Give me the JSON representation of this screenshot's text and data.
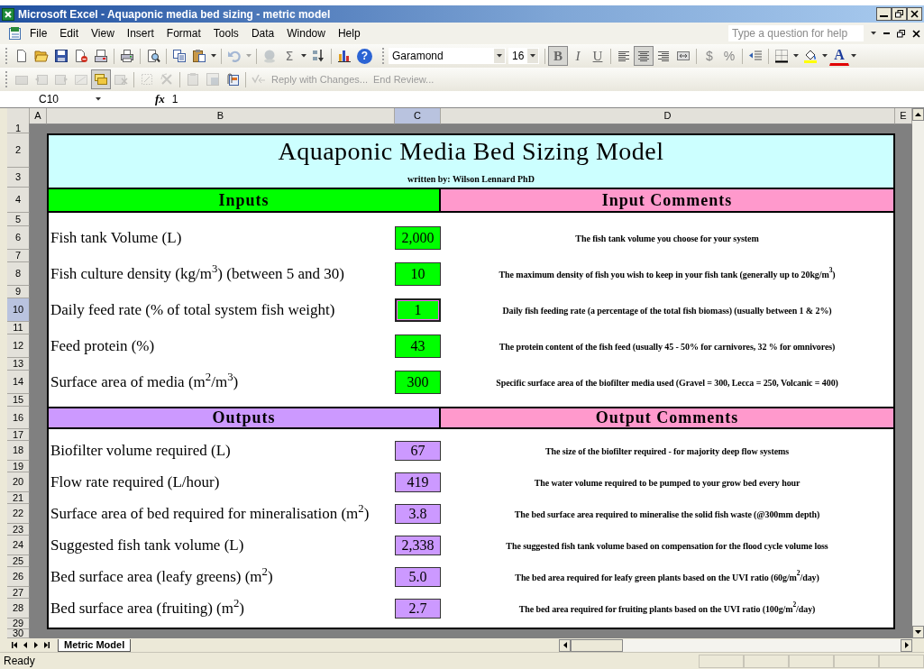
{
  "window": {
    "title": "Microsoft Excel - Aquaponic media bed sizing - metric model"
  },
  "menu": [
    "File",
    "Edit",
    "View",
    "Insert",
    "Format",
    "Tools",
    "Data",
    "Window",
    "Help"
  ],
  "help_box": {
    "placeholder": "Type a question for help"
  },
  "standard_toolbar": [
    {
      "kind": "icon",
      "disabled": false
    },
    {
      "kind": "icon",
      "disabled": false
    },
    {
      "kind": "icon",
      "disabled": false
    },
    {
      "kind": "icon",
      "disabled": false
    },
    {
      "kind": "icon",
      "disabled": false
    },
    {
      "kind": "separator"
    },
    {
      "kind": "icon",
      "disabled": false
    },
    {
      "kind": "separator"
    },
    {
      "kind": "icon",
      "disabled": false
    },
    {
      "kind": "separator"
    },
    {
      "kind": "icon",
      "disabled": false
    },
    {
      "kind": "icon",
      "disabled": false
    },
    {
      "kind": "icon",
      "disabled": false
    },
    {
      "kind": "separator"
    },
    {
      "kind": "icon",
      "disabled": true
    },
    {
      "kind": "icon",
      "disabled": true
    },
    {
      "kind": "separator"
    },
    {
      "kind": "icon",
      "disabled": true
    },
    {
      "kind": "glyph",
      "text": "Σ",
      "disabled": false
    },
    {
      "kind": "icon",
      "disabled": false
    },
    {
      "kind": "icon",
      "disabled": false
    },
    {
      "kind": "separator"
    },
    {
      "kind": "icon",
      "disabled": false
    },
    {
      "kind": "round-glyph",
      "text": "?",
      "disabled": false
    }
  ],
  "formatting_toolbar": [
    {
      "kind": "field",
      "value": "Garamond"
    },
    {
      "kind": "field",
      "value": "16"
    },
    {
      "kind": "separator"
    },
    {
      "kind": "glyph",
      "text": "B",
      "selected": true
    },
    {
      "kind": "glyph",
      "text": "I",
      "selected": false
    },
    {
      "kind": "glyph",
      "text": "U",
      "selected": false
    },
    {
      "kind": "separator"
    },
    {
      "kind": "icon",
      "selected": false
    },
    {
      "kind": "icon",
      "selected": true
    },
    {
      "kind": "icon",
      "selected": false
    },
    {
      "kind": "icon",
      "selected": false
    },
    {
      "kind": "separator"
    },
    {
      "kind": "glyph",
      "text": "$",
      "selected": false
    },
    {
      "kind": "glyph",
      "text": "%",
      "selected": false
    },
    {
      "kind": "separator"
    },
    {
      "kind": "icon",
      "selected": false
    },
    {
      "kind": "separator"
    },
    {
      "kind": "icon",
      "selected": false
    },
    {
      "kind": "icon",
      "selected": false
    },
    {
      "kind": "icon",
      "selected": false
    },
    {
      "kind": "icon",
      "selected": false
    },
    {
      "kind": "glyph",
      "text": "A",
      "selected": false
    },
    {
      "kind": "icon",
      "selected": false
    }
  ],
  "review_toolbar": [
    {
      "kind": "icon",
      "selected": false,
      "disabled": true
    },
    {
      "kind": "icon",
      "selected": false,
      "disabled": true
    },
    {
      "kind": "icon",
      "selected": false,
      "disabled": true
    },
    {
      "kind": "icon",
      "selected": false,
      "disabled": true
    },
    {
      "kind": "icon",
      "selected": true,
      "disabled": false
    },
    {
      "kind": "icon",
      "selected": false,
      "disabled": true
    },
    {
      "kind": "separator"
    },
    {
      "kind": "icon",
      "selected": false,
      "disabled": true
    },
    {
      "kind": "icon",
      "selected": false,
      "disabled": true
    },
    {
      "kind": "separator"
    },
    {
      "kind": "icon",
      "selected": false,
      "disabled": true
    },
    {
      "kind": "icon",
      "selected": false,
      "disabled": true
    },
    {
      "kind": "icon",
      "selected": false,
      "disabled": false
    },
    {
      "kind": "separator"
    },
    {
      "kind": "icon",
      "selected": false,
      "disabled": true
    },
    {
      "kind": "text",
      "text": "Reply with Changes...",
      "selected": false,
      "disabled": true
    },
    {
      "kind": "text",
      "text": "End Review...",
      "selected": false,
      "disabled": true
    }
  ],
  "formula_bar": {
    "name_box": "C10",
    "fx": "fx",
    "formula": "1"
  },
  "columns": [
    {
      "label": "A",
      "selected": false
    },
    {
      "label": "B",
      "selected": false
    },
    {
      "label": "C",
      "selected": true
    },
    {
      "label": "D",
      "selected": false
    },
    {
      "label": "E",
      "selected": false
    }
  ],
  "rows": [
    {
      "label": "1",
      "selected": false
    },
    {
      "label": "2",
      "selected": false
    },
    {
      "label": "3",
      "selected": false
    },
    {
      "label": "4",
      "selected": false
    },
    {
      "label": "5",
      "selected": false
    },
    {
      "label": "6",
      "selected": false
    },
    {
      "label": "7",
      "selected": false
    },
    {
      "label": "8",
      "selected": false
    },
    {
      "label": "9",
      "selected": false
    },
    {
      "label": "10",
      "selected": true
    },
    {
      "label": "11",
      "selected": false
    },
    {
      "label": "12",
      "selected": false
    },
    {
      "label": "13",
      "selected": false
    },
    {
      "label": "14",
      "selected": false
    },
    {
      "label": "15",
      "selected": false
    },
    {
      "label": "16",
      "selected": false
    },
    {
      "label": "17",
      "selected": false
    },
    {
      "label": "18",
      "selected": false
    },
    {
      "label": "19",
      "selected": false
    },
    {
      "label": "20",
      "selected": false
    },
    {
      "label": "21",
      "selected": false
    },
    {
      "label": "22",
      "selected": false
    },
    {
      "label": "23",
      "selected": false
    },
    {
      "label": "24",
      "selected": false
    },
    {
      "label": "25",
      "selected": false
    },
    {
      "label": "26",
      "selected": false
    },
    {
      "label": "27",
      "selected": false
    },
    {
      "label": "28",
      "selected": false
    },
    {
      "label": "29",
      "selected": false
    },
    {
      "label": "30",
      "selected": false
    }
  ],
  "sheet": {
    "title": "Aquaponic Media Bed Sizing Model",
    "author": "written by: Wilson Lennard PhD",
    "sections": [
      {
        "title": "Inputs",
        "color": "#00ff00",
        "comments_title": "Input Comments",
        "items": [
          {
            "label": "Fish tank Volume (L)",
            "value": "2,000",
            "comment": "The fish tank volume you choose for your system",
            "selected": false
          },
          {
            "label": "Fish culture density (kg/m$^{3}$) (between 5 and 30)",
            "value": "10",
            "comment": "The maximum density of fish you wish to keep in your fish tank (generally up to 20kg/m$^{3}$)",
            "selected": false
          },
          {
            "label": "Daily feed rate (% of total system fish weight)",
            "value": "1",
            "comment": "Daily fish feeding rate (a percentage of the total fish biomass)  (usually between 1 & 2%)",
            "selected": true
          },
          {
            "label": "Feed protein (%)",
            "value": "43",
            "comment": "The protein content of the fish feed (usually 45 - 50% for carnivores, 32 % for omnivores)",
            "selected": false
          },
          {
            "label": "Surface area of media (m$^{2}$/m$^{3}$)",
            "value": "300",
            "comment": "Specific surface area of the biofilter media used (Gravel = 300, Lecca = 250, Volcanic = 400)",
            "selected": false
          }
        ]
      },
      {
        "title": "Outputs",
        "color": "#cc99ff",
        "comments_title": "Output Comments",
        "items": [
          {
            "label": "Biofilter volume required (L)",
            "value": "67",
            "comment": "The size of the biofilter required - for majority deep flow systems",
            "selected": false
          },
          {
            "label": "Flow rate required (L/hour)",
            "value": "419",
            "comment": "The water volume required to be pumped to your grow bed every hour",
            "selected": false
          },
          {
            "label": "Surface area of bed required for mineralisation (m$^{2}$)",
            "value": "3.8",
            "comment": "The bed surface area required to mineralise the solid fish waste (@300mm depth)",
            "selected": false
          },
          {
            "label": "Suggested fish tank volume (L)",
            "value": "2,338",
            "comment": "The suggested fish tank volume based on compensation for the flood cycle volume loss",
            "selected": false
          },
          {
            "label": "Bed surface area (leafy greens) (m$^{2}$)",
            "value": "5.0",
            "comment": "The bed area required for leafy green plants based on the UVI ratio (60g/m$^{2}$/day)",
            "selected": false
          },
          {
            "label": "Bed surface area (fruiting) (m$^{2}$)",
            "value": "2.7",
            "comment": "The bed area required for fruiting plants based on the UVI ratio (100g/m$^{2}$/day)",
            "selected": false
          }
        ]
      }
    ]
  },
  "sheet_tabs": [
    {
      "label": "Metric Model",
      "selected": true
    }
  ],
  "status_bar": {
    "text": "Ready"
  }
}
